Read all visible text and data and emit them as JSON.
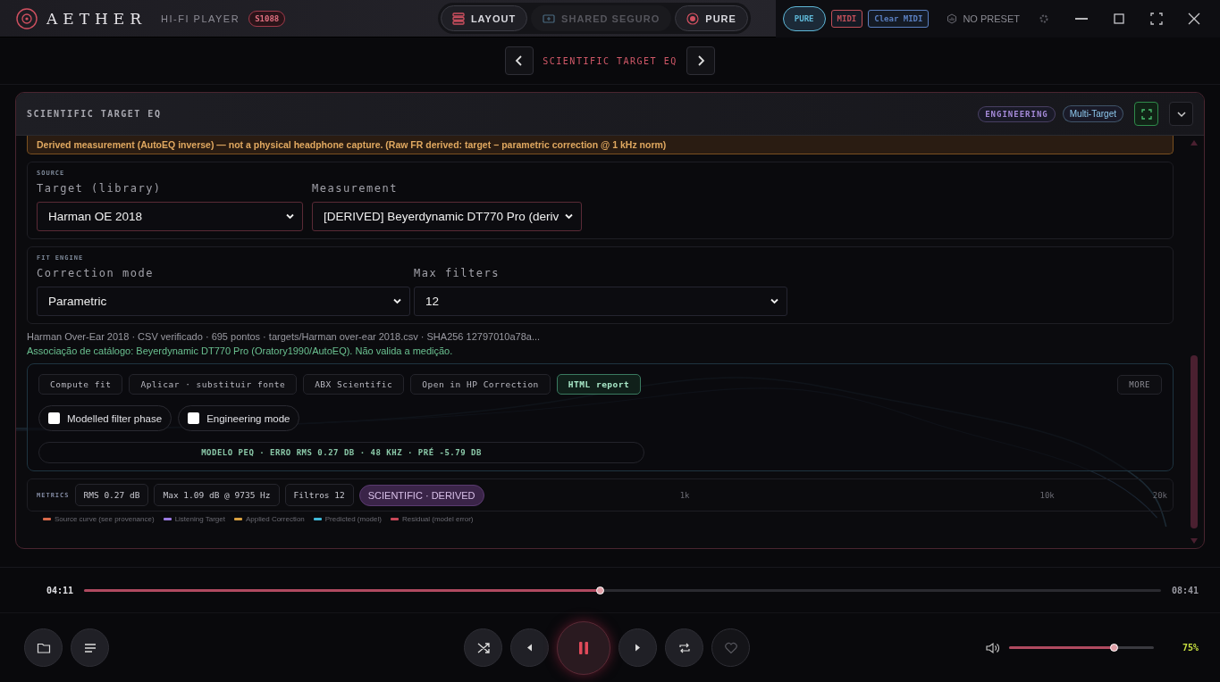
{
  "app": {
    "name": "AETHER",
    "subtitle": "HI-FI PLAYER",
    "build": "S1088"
  },
  "modes": [
    {
      "kind": "layout",
      "label": "LAYOUT",
      "disabled": false
    },
    {
      "kind": "shared",
      "label": "SHARED SEGURO",
      "disabled": true
    },
    {
      "kind": "pure",
      "label": "PURE",
      "disabled": false
    }
  ],
  "tags": [
    {
      "label": "PURE",
      "color": "#5fb8d8"
    },
    {
      "label": "MIDI",
      "color": "#c0505a"
    },
    {
      "label": "Clear MIDI",
      "color": "#5a7fc0"
    }
  ],
  "preset": "NO PRESET",
  "nav": {
    "title": "SCIENTIFIC TARGET EQ"
  },
  "panel": {
    "title": "SCIENTIFIC TARGET EQ",
    "badges": [
      {
        "label": "ENGINEERING",
        "color": "#a48ad8"
      },
      {
        "label": "Multi-Target",
        "color": "#8ec8ee"
      }
    ],
    "warning": "Derived measurement (AutoEQ inverse) — not a physical headphone capture. (Raw FR derived: target − parametric correction @ 1 kHz norm)",
    "source": {
      "label": "SOURCE",
      "fields": [
        {
          "label": "Target (library)",
          "value": "Harman OE 2018"
        },
        {
          "label": "Measurement",
          "value": "[DERIVED] Beyerdynamic DT770 Pro (deriv"
        }
      ]
    },
    "fit_engine": {
      "label": "FIT ENGINE",
      "fields": [
        {
          "label": "Correction mode",
          "value": "Parametric"
        },
        {
          "label": "Max filters",
          "value": "12"
        }
      ]
    },
    "info": "Harman Over-Ear 2018 · CSV verificado · 695 pontos · targets/Harman over-ear 2018.csv · SHA256 12797010a78a...",
    "association": "Associação de catálogo: Beyerdynamic DT770 Pro (Oratory1990/AutoEQ). Não valida a medição.",
    "actions": [
      {
        "label": "Compute fit",
        "selected": false
      },
      {
        "label": "Aplicar · substituir fonte",
        "selected": false
      },
      {
        "label": "ABX Scientific",
        "selected": false
      },
      {
        "label": "Open in HP Correction",
        "selected": false
      },
      {
        "label": "HTML report",
        "selected": true
      }
    ],
    "more": "MORE",
    "options": [
      {
        "label": "Modelled filter phase",
        "checked": false
      },
      {
        "label": "Engineering mode",
        "checked": false
      }
    ],
    "summary": "MODELO PEQ · ERRO RMS 0.27 DB · 48 KHZ · PRÉ -5.79 DB",
    "metrics": {
      "label": "METRICS",
      "chips": [
        "RMS 0.27 dB",
        "Max 1.09 dB @ 9735 Hz",
        "Filtros 12"
      ],
      "tag": "SCIENTIFIC · DERIVED"
    },
    "axis_labels": [
      "1k",
      "10k",
      "20k"
    ],
    "legend": [
      {
        "label": "Source curve (see provenance)",
        "color": "#d8694a"
      },
      {
        "label": "Listening Target",
        "color": "#9a7ae0"
      },
      {
        "label": "Applied Correction",
        "color": "#d8a040"
      },
      {
        "label": "Predicted (model)",
        "color": "#40b8d8"
      },
      {
        "label": "Residual (model error)",
        "color": "#c84858"
      }
    ]
  },
  "player": {
    "elapsed": "04:11",
    "total": "08:41",
    "level": 0.48,
    "playing": true,
    "favorite": false,
    "volume": {
      "level": 0.73,
      "reading": "75%"
    }
  }
}
